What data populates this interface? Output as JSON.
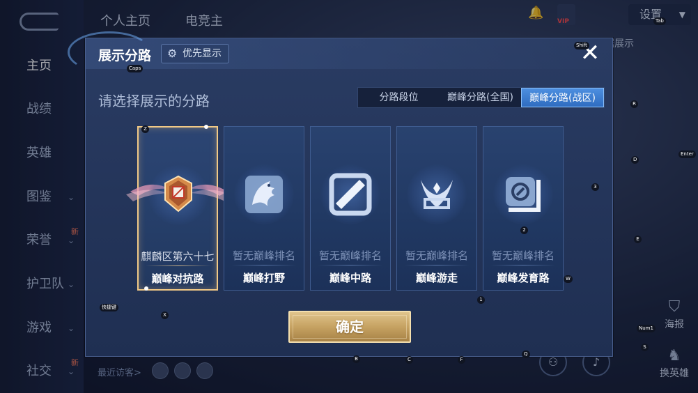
{
  "nav": {
    "items": [
      {
        "label": "主页",
        "active": true
      },
      {
        "label": "战绩"
      },
      {
        "label": "英雄"
      },
      {
        "label": "图鉴"
      },
      {
        "label": "荣誉",
        "badge": "新"
      },
      {
        "label": "护卫队"
      },
      {
        "label": "游戏"
      },
      {
        "label": "社交",
        "badge": "新"
      }
    ]
  },
  "topbar": {
    "tabs": [
      "个人主页",
      "电竞主"
    ],
    "settings_label": "设置",
    "vip_label": "VIP",
    "right_label": "据展示"
  },
  "side_buttons": {
    "report": "海报",
    "switch_hero": "换英雄"
  },
  "footer": {
    "recent_visitors": "最近访客>"
  },
  "dialog": {
    "title": "展示分路",
    "priority_label": "优先显示",
    "close_label": "✕",
    "prompt": "请选择展示的分路",
    "tabs": [
      {
        "label": "分路段位",
        "active": false
      },
      {
        "label": "巅峰分路(全国)",
        "active": false
      },
      {
        "label": "巅峰分路(战区)",
        "active": true
      }
    ],
    "cards": [
      {
        "rank": "麒麟区第六十七",
        "lane": "巅峰对抗路",
        "selected": true,
        "icon": "rank-badge-icon"
      },
      {
        "rank": "暂无巅峰排名",
        "lane": "巅峰打野",
        "selected": false,
        "icon": "jungle-dragon-icon"
      },
      {
        "rank": "暂无巅峰排名",
        "lane": "巅峰中路",
        "selected": false,
        "icon": "mid-lane-icon"
      },
      {
        "rank": "暂无巅峰排名",
        "lane": "巅峰游走",
        "selected": false,
        "icon": "support-wings-icon"
      },
      {
        "rank": "暂无巅峰排名",
        "lane": "巅峰发育路",
        "selected": false,
        "icon": "adc-lane-icon"
      }
    ],
    "confirm_label": "确定"
  },
  "key_hints": [
    "Caps",
    "Z",
    "X",
    "Shift",
    "R",
    "D",
    "3",
    "Enter",
    "E",
    "W",
    "2",
    "1",
    "Num1",
    "S",
    "B",
    "C",
    "F",
    "Q",
    "Tab",
    "快捷键"
  ]
}
